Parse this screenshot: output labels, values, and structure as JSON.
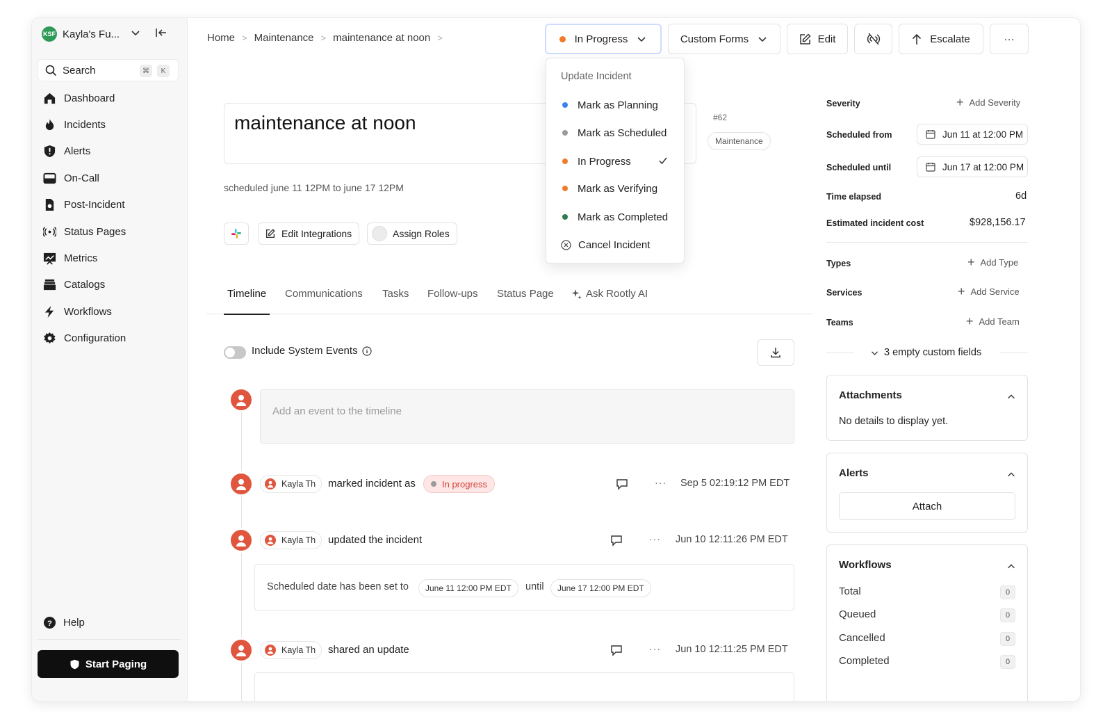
{
  "workspace": {
    "initials": "KSF",
    "name": "Kayla's Fu..."
  },
  "search": {
    "label": "Search",
    "shortcut_cmd": "⌘",
    "shortcut_key": "K"
  },
  "nav": [
    {
      "label": "Dashboard",
      "icon": "home-icon"
    },
    {
      "label": "Incidents",
      "icon": "flame-icon"
    },
    {
      "label": "Alerts",
      "icon": "shield-alert-icon"
    },
    {
      "label": "On-Call",
      "icon": "calendar-icon"
    },
    {
      "label": "Post-Incident",
      "icon": "document-icon"
    },
    {
      "label": "Status Pages",
      "icon": "broadcast-icon"
    },
    {
      "label": "Metrics",
      "icon": "chart-icon"
    },
    {
      "label": "Catalogs",
      "icon": "stack-icon"
    },
    {
      "label": "Workflows",
      "icon": "bolt-icon"
    },
    {
      "label": "Configuration",
      "icon": "gear-icon"
    }
  ],
  "help_label": "Help",
  "start_paging_label": "Start Paging",
  "breadcrumb": [
    "Home",
    "Maintenance",
    "maintenance at noon"
  ],
  "header": {
    "status_label": "In Progress",
    "status_color": "#f07b2a",
    "custom_forms_label": "Custom Forms",
    "edit_label": "Edit",
    "escalate_label": "Escalate",
    "more_label": "···"
  },
  "dropdown": {
    "header": "Update Incident",
    "items": [
      {
        "label": "Mark as Planning",
        "color": "#3b82f6"
      },
      {
        "label": "Mark as Scheduled",
        "color": "#9a9a9a"
      },
      {
        "label": "In Progress",
        "color": "#f07b2a",
        "checked": true
      },
      {
        "label": "Mark as Verifying",
        "color": "#f07b2a"
      },
      {
        "label": "Mark as Completed",
        "color": "#2f7d4f"
      },
      {
        "label": "Cancel Incident",
        "color": ""
      }
    ]
  },
  "incident": {
    "title": "maintenance at noon",
    "number": "#62",
    "type_tag": "Maintenance",
    "subtitle": "scheduled june 11 12PM to june 17 12PM",
    "edit_integrations_label": "Edit Integrations",
    "assign_roles_label": "Assign Roles"
  },
  "tabs": [
    "Timeline",
    "Communications",
    "Tasks",
    "Follow-ups",
    "Status Page",
    "Ask Rootly AI"
  ],
  "timeline": {
    "include_system_events_label": "Include System Events",
    "input_placeholder": "Add an event to the timeline",
    "events": [
      {
        "actor": "Kayla Th",
        "text": "marked incident as",
        "status": "In progress",
        "time": "Sep 5 02:19:12 PM EDT"
      },
      {
        "actor": "Kayla Th",
        "text": "updated the incident",
        "time": "Jun 10 12:11:26 PM EDT",
        "detail_prefix": "Scheduled date has been set to",
        "detail_from": "June 11 12:00 PM EDT",
        "detail_mid": "until",
        "detail_to": "June 17 12:00 PM EDT"
      },
      {
        "actor": "Kayla Th",
        "text": "shared an update",
        "time": "Jun 10 12:11:25 PM EDT"
      }
    ]
  },
  "right_panel": {
    "severity_label": "Severity",
    "add_severity": "Add Severity",
    "scheduled_from_label": "Scheduled from",
    "scheduled_from": "Jun 11 at 12:00 PM",
    "scheduled_until_label": "Scheduled until",
    "scheduled_until": "Jun 17 at 12:00 PM",
    "time_elapsed_label": "Time elapsed",
    "time_elapsed": "6d",
    "cost_label": "Estimated incident cost",
    "cost": "$928,156.17",
    "types_label": "Types",
    "add_type": "Add Type",
    "services_label": "Services",
    "add_service": "Add Service",
    "teams_label": "Teams",
    "add_team": "Add Team",
    "empty_fields": "3 empty custom fields",
    "attachments_title": "Attachments",
    "attachments_empty": "No details to display yet.",
    "alerts_title": "Alerts",
    "attach_label": "Attach",
    "workflows_title": "Workflows",
    "workflows": [
      {
        "label": "Total",
        "count": "0"
      },
      {
        "label": "Queued",
        "count": "0"
      },
      {
        "label": "Cancelled",
        "count": "0"
      },
      {
        "label": "Completed",
        "count": "0"
      }
    ]
  }
}
